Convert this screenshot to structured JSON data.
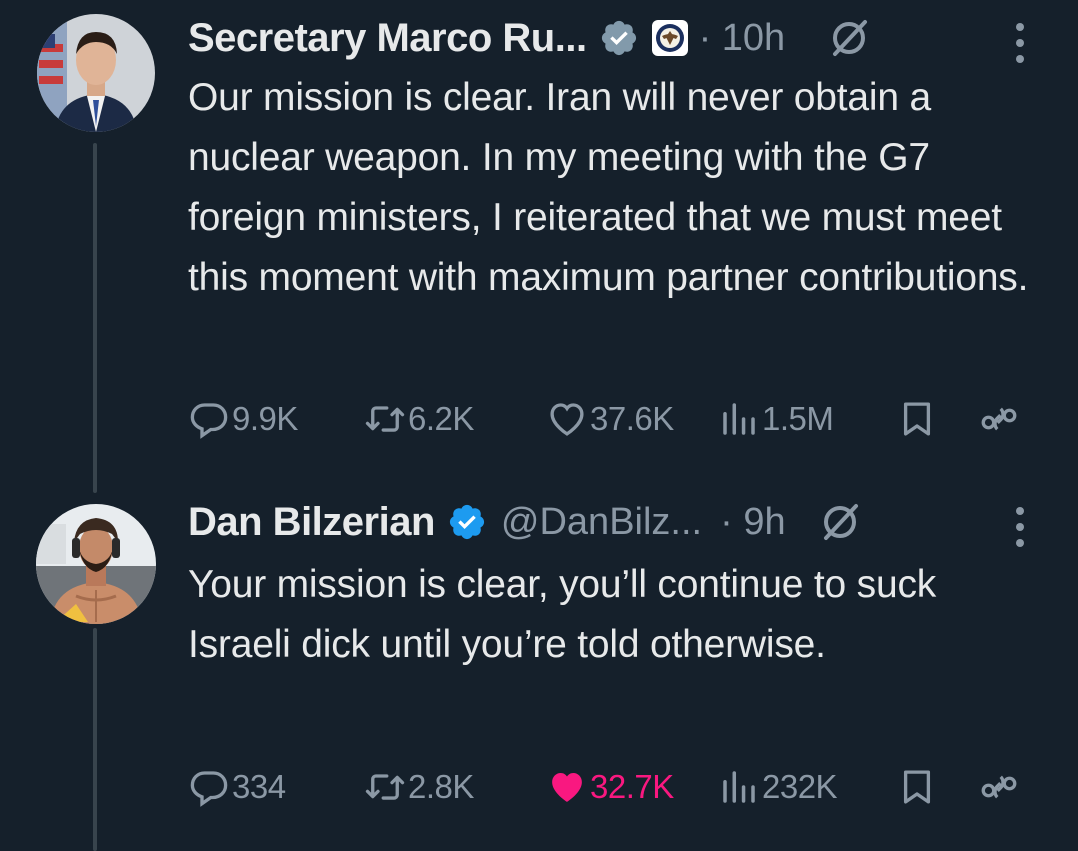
{
  "tweets": [
    {
      "author_name": "Secretary Marco Ru...",
      "handle": "",
      "time": "· 10h",
      "body": "Our mission is clear. Iran will never obtain a nuclear weapon. In my meeting with the G7 foreign ministers, I reiterated that we must meet this moment with maximum partner contributions.",
      "replies": "9.9K",
      "reposts": "6.2K",
      "likes": "37.6K",
      "views": "1.5M",
      "verified_badge": "gray-check-icon",
      "liked": false
    },
    {
      "author_name": "Dan Bilzerian",
      "handle": "@DanBilz...",
      "time": "· 9h",
      "body": "Your mission is clear, you’ll continue to suck Israeli dick until you’re told otherwise.",
      "replies": "334",
      "reposts": "2.8K",
      "likes": "32.7K",
      "views": "232K",
      "verified_badge": "blue-check-icon",
      "liked": true
    }
  ],
  "colors": {
    "background": "#15202b",
    "text": "#e7e9ea",
    "muted": "#8b98a5",
    "like": "#f91880",
    "verified_blue": "#1d9bf0",
    "verified_gray": "#829aab"
  }
}
